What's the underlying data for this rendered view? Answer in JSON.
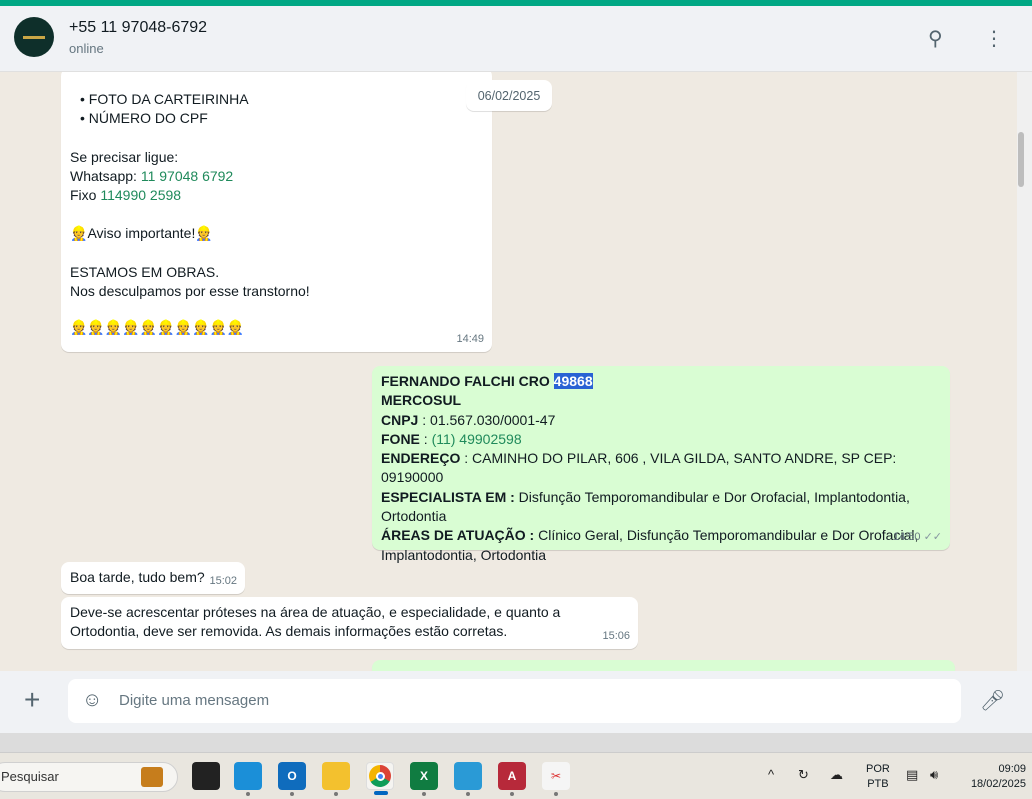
{
  "header": {
    "contact": "+55 11 97048-6792",
    "status": "online"
  },
  "date_chip": "06/02/2025",
  "messages": {
    "m1": {
      "bullets": [
        "FOTO DA CARTEIRINHA",
        "NÚMERO DO CPF"
      ],
      "call": "Se precisar ligue:",
      "wa_label": "Whatsapp:",
      "wa_num": "11 97048 6792",
      "fixo_label": "Fixo",
      "fixo_num": "114990 2598",
      "aviso": "Aviso importante!",
      "obras": "ESTAMOS EM OBRAS.",
      "desculpas": "Nos desculpamos por esse transtorno!",
      "worker_emoji": "👷",
      "workers": "👷👷👷👷👷👷👷👷👷👷",
      "time": "14:49"
    },
    "m2": {
      "name": "FERNANDO FALCHI  CRO ",
      "cro": "49868",
      "org": " MERCOSUL",
      "cnpj_l": "CNPJ",
      "cnpj": " : 01.567.030/0001-47",
      "fone_l": "FONE",
      "fone_sep": " : ",
      "fone": "(11) 49902598",
      "end_l": "ENDEREÇO",
      "end": " : CAMINHO DO PILAR, 606 , VILA GILDA, SANTO ANDRE, SP CEP: 09190000",
      "esp_l": "ESPECIALISTA EM :",
      "esp": " Disfunção Temporomandibular e Dor Orofacial, Implantodontia, Ortodontia",
      "areas_l": "ÁREAS DE ATUAÇÃO :",
      "areas": " Clínico Geral, Disfunção Temporomandibular e Dor Orofacial, Implantodontia, Ortodontia",
      "time": "14:50",
      "ticks": "✓✓"
    },
    "m3": {
      "text": "Boa tarde, tudo bem?",
      "time": "15:02"
    },
    "m4": {
      "text": "Deve-se acrescentar próteses na área de atuação, e especialidade, e quanto a Ortodontia, deve ser removida. As demais informações estão corretas.",
      "time": "15:06"
    }
  },
  "input": {
    "placeholder": "Digite uma mensagem"
  },
  "taskbar": {
    "search": "Pesquisar",
    "lang1": "POR",
    "lang2": "PTB",
    "time": "09:09",
    "date": "18/02/2025"
  }
}
